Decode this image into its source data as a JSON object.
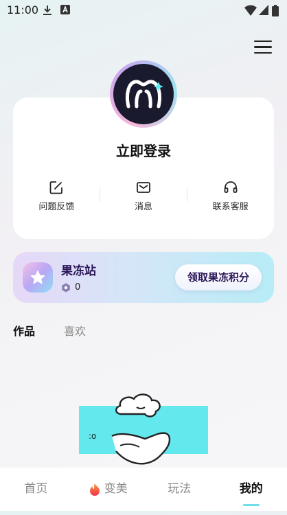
{
  "status_bar": {
    "time": "11:00",
    "icons": [
      "download-icon",
      "a-box-icon",
      "wifi-icon",
      "signal-icon",
      "battery-icon"
    ]
  },
  "header": {
    "menu_icon": "hamburger-menu-icon"
  },
  "profile": {
    "login_label": "立即登录",
    "actions": [
      {
        "label": "问题反馈",
        "icon": "edit-icon"
      },
      {
        "label": "消息",
        "icon": "mail-icon"
      },
      {
        "label": "联系客服",
        "icon": "headset-icon"
      }
    ]
  },
  "jelly_station": {
    "title": "果冻站",
    "points": "0",
    "button_label": "领取果冻积分"
  },
  "content_tabs": [
    {
      "label": "作品",
      "active": true
    },
    {
      "label": "喜欢",
      "active": false
    }
  ],
  "bottom_nav": [
    {
      "label": "首页",
      "active": false
    },
    {
      "label": "变美",
      "active": false,
      "icon": "fire-icon"
    },
    {
      "label": "玩法",
      "active": false
    },
    {
      "label": "我的",
      "active": true
    }
  ],
  "colors": {
    "accent": "#6fe0ea",
    "jelly_text": "#2a1457",
    "illustration_teal": "#63e8ee"
  }
}
